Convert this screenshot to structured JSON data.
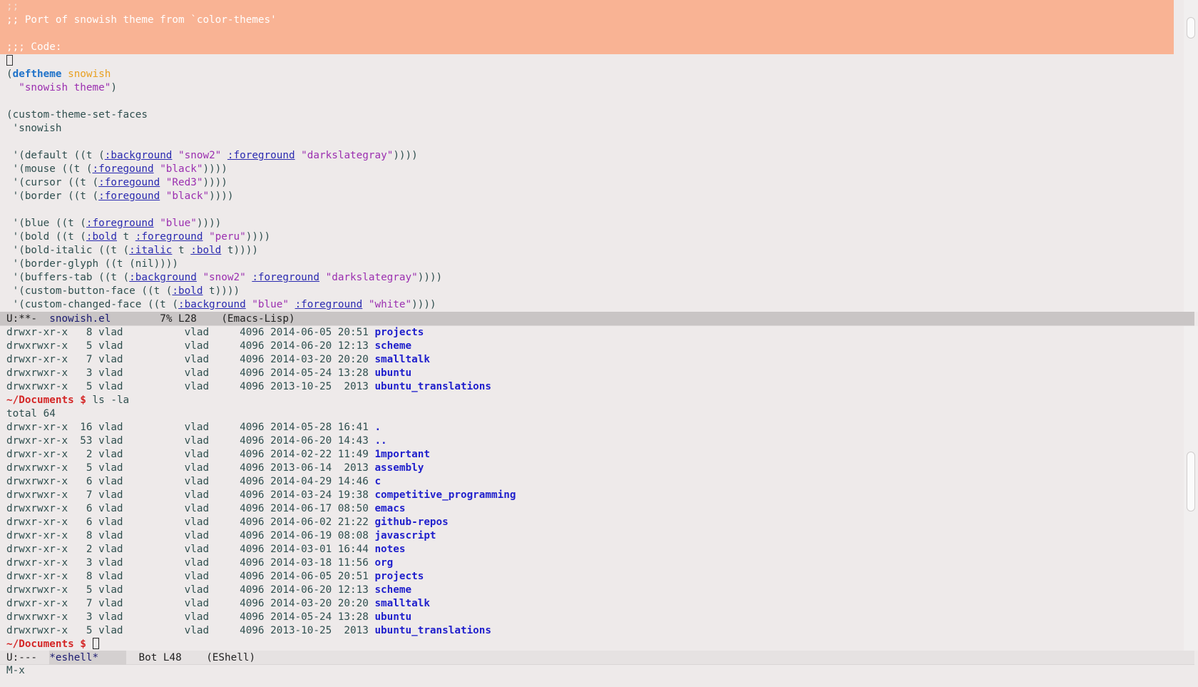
{
  "top_buffer": {
    "comment_lines": [
      ";;",
      ";; Port of snowish theme from `color-themes'",
      "",
      ";;; Code:"
    ],
    "code": {
      "deftheme_kw": "deftheme",
      "deftheme_name": "snowish",
      "deftheme_doc": "\"snowish theme\"",
      "custom_set": "(custom-theme-set-faces",
      "quoted_name": " 'snowish",
      "faces": [
        {
          "pre": " '(default ((t (",
          "k1": ":background",
          "v1": " \"snow2\" ",
          "k2": ":foreground",
          "v2": " \"darkslategray\"",
          "post": "))))"
        },
        {
          "pre": " '(mouse ((t (",
          "k1": ":foregound",
          "v1": " \"black\"",
          "post": "))))"
        },
        {
          "pre": " '(cursor ((t (",
          "k1": ":foregound",
          "v1": " \"Red3\"",
          "post": "))))"
        },
        {
          "pre": " '(border ((t (",
          "k1": ":foregound",
          "v1": " \"black\"",
          "post": "))))"
        },
        {
          "pre": " '(blue ((t (",
          "k1": ":foreground",
          "v1": " \"blue\"",
          "post": "))))"
        },
        {
          "pre": " '(bold ((t (",
          "k1": ":bold",
          "mid": " t ",
          "k2": ":foreground",
          "v2": " \"peru\"",
          "post": "))))"
        },
        {
          "pre": " '(bold-italic ((t (",
          "k1": ":italic",
          "mid": " t ",
          "k2": ":bold",
          "tail": " t",
          "post": "))))"
        },
        {
          "pre": " '(border-glyph ((t (nil))))"
        },
        {
          "pre": " '(buffers-tab ((t (",
          "k1": ":background",
          "v1": " \"snow2\" ",
          "k2": ":foreground",
          "v2": " \"darkslategray\"",
          "post": "))))"
        },
        {
          "pre": " '(custom-button-face ((t (",
          "k1": ":bold",
          "tail": " t",
          "post": "))))"
        },
        {
          "pre": " '(custom-changed-face ((t (",
          "k1": ":background",
          "v1": " \"blue\" ",
          "k2": ":foreground",
          "v2": " \"white\"",
          "post": "))))"
        }
      ]
    }
  },
  "top_modeline": {
    "status": "U:**-  ",
    "buffer": "snowish.el",
    "position": "7% L28",
    "mode": "(Emacs-Lisp)"
  },
  "eshell": {
    "prev_rows": [
      {
        "perm": "drwxr-xr-x",
        "links": "8",
        "user": "vlad",
        "group": "vlad",
        "size": "4096",
        "date": "2014-06-05",
        "time": "20:51",
        "name": "projects"
      },
      {
        "perm": "drwxrwxr-x",
        "links": "5",
        "user": "vlad",
        "group": "vlad",
        "size": "4096",
        "date": "2014-06-20",
        "time": "12:13",
        "name": "scheme"
      },
      {
        "perm": "drwxr-xr-x",
        "links": "7",
        "user": "vlad",
        "group": "vlad",
        "size": "4096",
        "date": "2014-03-20",
        "time": "20:20",
        "name": "smalltalk"
      },
      {
        "perm": "drwxrwxr-x",
        "links": "3",
        "user": "vlad",
        "group": "vlad",
        "size": "4096",
        "date": "2014-05-24",
        "time": "13:28",
        "name": "ubuntu"
      },
      {
        "perm": "drwxrwxr-x",
        "links": "5",
        "user": "vlad",
        "group": "vlad",
        "size": "4096",
        "date": "2013-10-25",
        "time": " 2013",
        "name": "ubuntu_translations"
      }
    ],
    "prompt": "~/Documents $",
    "command": " ls -la",
    "total": "total 64",
    "rows": [
      {
        "perm": "drwxr-xr-x",
        "links": "16",
        "user": "vlad",
        "group": "vlad",
        "size": "4096",
        "date": "2014-05-28",
        "time": "16:41",
        "name": "."
      },
      {
        "perm": "drwxr-xr-x",
        "links": "53",
        "user": "vlad",
        "group": "vlad",
        "size": "4096",
        "date": "2014-06-20",
        "time": "14:43",
        "name": ".."
      },
      {
        "perm": "drwxr-xr-x",
        "links": "2",
        "user": "vlad",
        "group": "vlad",
        "size": "4096",
        "date": "2014-02-22",
        "time": "11:49",
        "name": "1mportant"
      },
      {
        "perm": "drwxrwxr-x",
        "links": "5",
        "user": "vlad",
        "group": "vlad",
        "size": "4096",
        "date": "2013-06-14",
        "time": " 2013",
        "name": "assembly"
      },
      {
        "perm": "drwxrwxr-x",
        "links": "6",
        "user": "vlad",
        "group": "vlad",
        "size": "4096",
        "date": "2014-04-29",
        "time": "14:46",
        "name": "c"
      },
      {
        "perm": "drwxrwxr-x",
        "links": "7",
        "user": "vlad",
        "group": "vlad",
        "size": "4096",
        "date": "2014-03-24",
        "time": "19:38",
        "name": "competitive_programming"
      },
      {
        "perm": "drwxrwxr-x",
        "links": "6",
        "user": "vlad",
        "group": "vlad",
        "size": "4096",
        "date": "2014-06-17",
        "time": "08:50",
        "name": "emacs"
      },
      {
        "perm": "drwxr-xr-x",
        "links": "6",
        "user": "vlad",
        "group": "vlad",
        "size": "4096",
        "date": "2014-06-02",
        "time": "21:22",
        "name": "github-repos"
      },
      {
        "perm": "drwxr-xr-x",
        "links": "8",
        "user": "vlad",
        "group": "vlad",
        "size": "4096",
        "date": "2014-06-19",
        "time": "08:08",
        "name": "javascript"
      },
      {
        "perm": "drwxr-xr-x",
        "links": "2",
        "user": "vlad",
        "group": "vlad",
        "size": "4096",
        "date": "2014-03-01",
        "time": "16:44",
        "name": "notes"
      },
      {
        "perm": "drwxr-xr-x",
        "links": "3",
        "user": "vlad",
        "group": "vlad",
        "size": "4096",
        "date": "2014-03-18",
        "time": "11:56",
        "name": "org"
      },
      {
        "perm": "drwxr-xr-x",
        "links": "8",
        "user": "vlad",
        "group": "vlad",
        "size": "4096",
        "date": "2014-06-05",
        "time": "20:51",
        "name": "projects"
      },
      {
        "perm": "drwxrwxr-x",
        "links": "5",
        "user": "vlad",
        "group": "vlad",
        "size": "4096",
        "date": "2014-06-20",
        "time": "12:13",
        "name": "scheme"
      },
      {
        "perm": "drwxr-xr-x",
        "links": "7",
        "user": "vlad",
        "group": "vlad",
        "size": "4096",
        "date": "2014-03-20",
        "time": "20:20",
        "name": "smalltalk"
      },
      {
        "perm": "drwxrwxr-x",
        "links": "3",
        "user": "vlad",
        "group": "vlad",
        "size": "4096",
        "date": "2014-05-24",
        "time": "13:28",
        "name": "ubuntu"
      },
      {
        "perm": "drwxrwxr-x",
        "links": "5",
        "user": "vlad",
        "group": "vlad",
        "size": "4096",
        "date": "2013-10-25",
        "time": " 2013",
        "name": "ubuntu_translations"
      }
    ],
    "final_prompt": "~/Documents $"
  },
  "bottom_modeline": {
    "status": "U:---  ",
    "buffer": "*eshell*",
    "position": "Bot L48",
    "mode": "(EShell)"
  },
  "minibuffer": {
    "text": "M-x"
  },
  "colors": {
    "highlight": "#f9b394",
    "directory": "#1f1fcc",
    "prompt": "#d42626",
    "keyword": "#1f72c9",
    "string": "#9b2fb0",
    "function_name": "#e8a020"
  }
}
